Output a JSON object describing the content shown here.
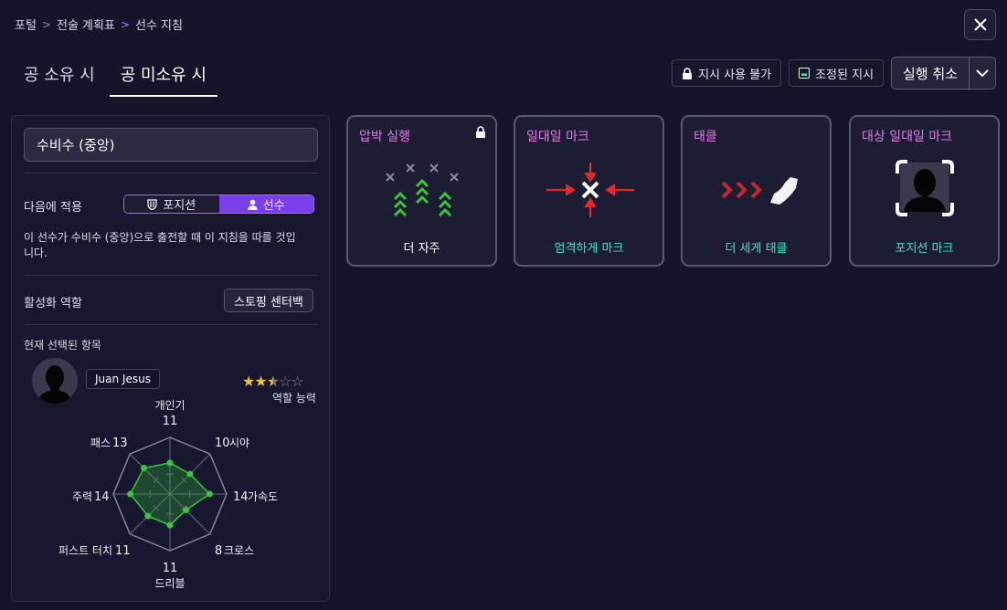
{
  "breadcrumb": {
    "items": [
      "포털",
      "전술 계획표",
      "선수 지침"
    ]
  },
  "tabs": [
    {
      "label": "공 소유 시",
      "active": false
    },
    {
      "label": "공 미소유 시",
      "active": true
    }
  ],
  "actions": {
    "unavailable_label": "지시 사용 불가",
    "adjusted_label": "조정된 지시",
    "undo_label": "실행 취소"
  },
  "left": {
    "position_value": "수비수 (중앙)",
    "apply_label": "다음에 적용",
    "toggle_position": "포지션",
    "toggle_player": "선수",
    "description": "이 선수가 수비수 (중앙)으로 출전할 때 이 지침을 따를 것입니다.",
    "role_label": "활성화 역할",
    "role_value": "스토핑 센터백",
    "selected_label": "현재 선택된 항목",
    "player_name": "Juan Jesus",
    "role_ability_label": "역할 능력",
    "stars": 2.5,
    "radar": [
      {
        "name": "개인기",
        "value": "11"
      },
      {
        "name": "시야",
        "value": "10"
      },
      {
        "name": "가속도",
        "value": "14"
      },
      {
        "name": "크로스",
        "value": "8"
      },
      {
        "name": "드리블",
        "value": "11"
      },
      {
        "name": "퍼스트 터치",
        "value": "11"
      },
      {
        "name": "주력",
        "value": "14"
      },
      {
        "name": "패스",
        "value": "13"
      }
    ]
  },
  "cards": [
    {
      "title": "압박 실행",
      "sub": "더 자주",
      "locked": true
    },
    {
      "title": "일대일 마크",
      "sub": "엄격하게 마크",
      "locked": false
    },
    {
      "title": "태클",
      "sub": "더 세게 태클",
      "locked": false
    },
    {
      "title": "대상 일대일 마크",
      "sub": "포지션 마크",
      "locked": false
    }
  ],
  "colors": {
    "accent": "#7a3fe8",
    "card_title": "#e87cf0",
    "teal": "#3ee0d0",
    "radar_green": "#3cc43c"
  }
}
